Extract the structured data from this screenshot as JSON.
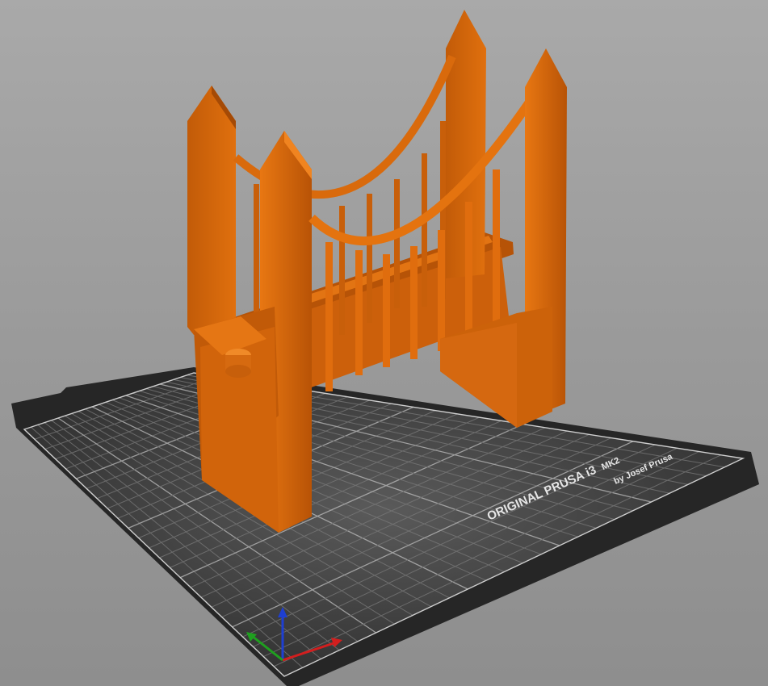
{
  "bed": {
    "brand_line1": "ORIGINAL PRUSA i3",
    "brand_model": "MK2",
    "brand_line2": "by Josef Prusa"
  },
  "colors": {
    "background_top": "#a9a9a9",
    "background_bottom": "#8e8e8e",
    "bed_frame": "#2b2b2b",
    "bed_surface": "#3a3a3a",
    "grid_line": "#6e6e6e",
    "model_orange": "#d9680a",
    "axis_x": "#d21e1e",
    "axis_y": "#1fa01f",
    "axis_z": "#1e3fd2"
  },
  "model": {
    "name_icon": "suspension-bridge-model"
  },
  "axes": {
    "icon": "xyz-axes-icon"
  }
}
